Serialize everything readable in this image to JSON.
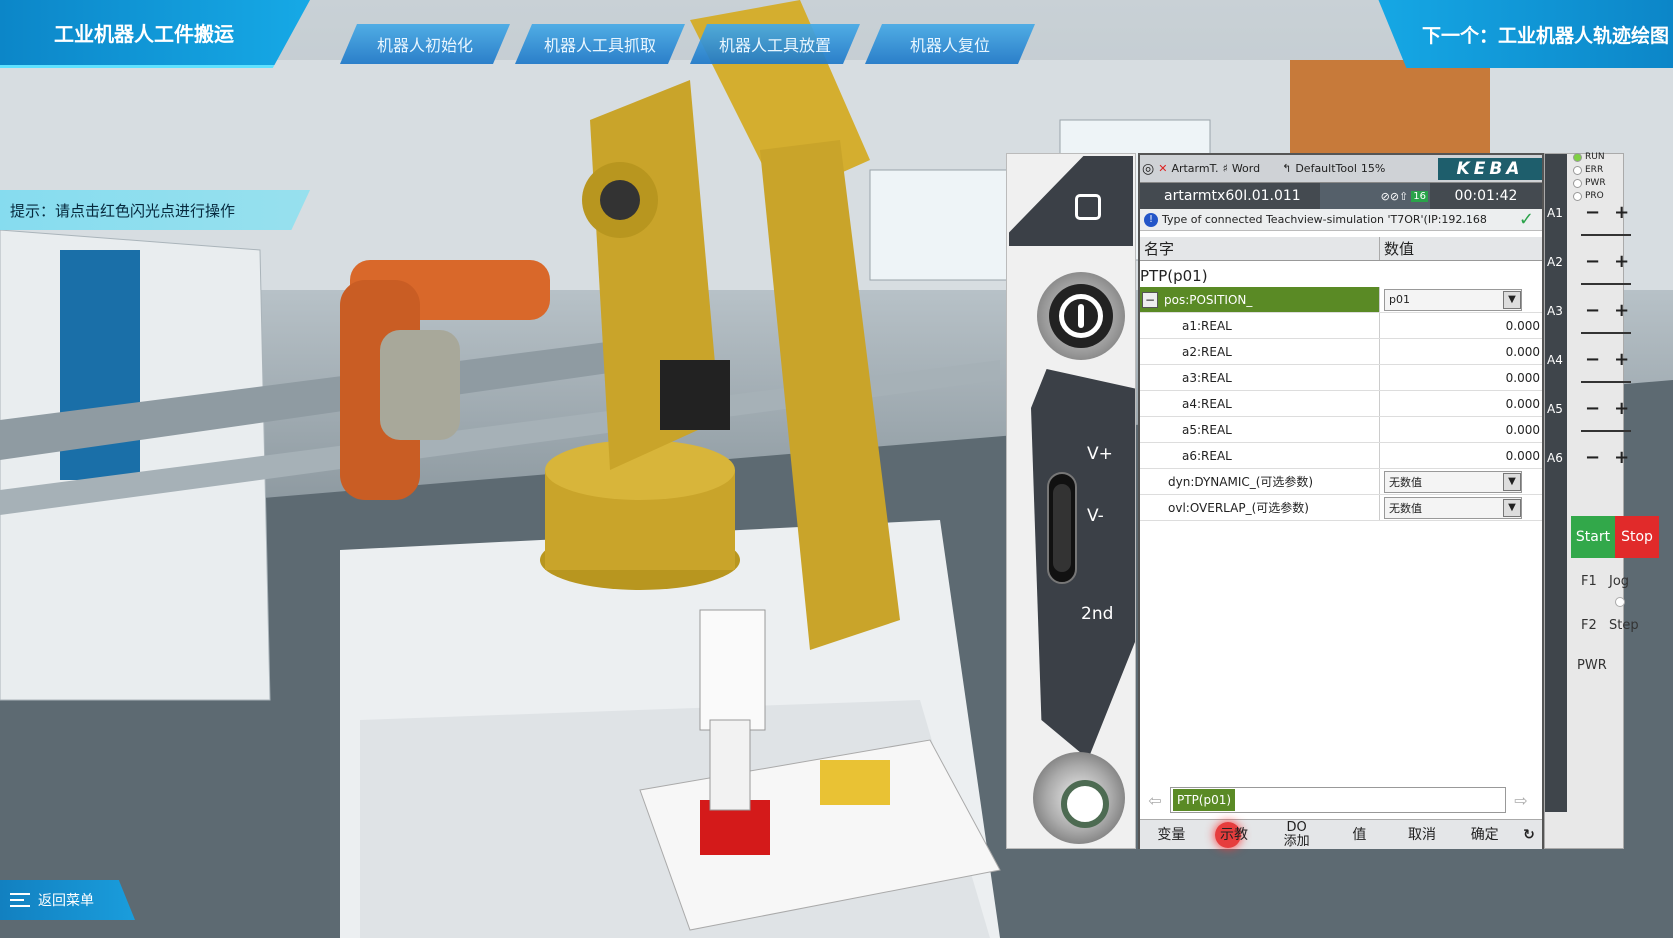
{
  "header": {
    "title": "工业机器人工件搬运",
    "next": "下一个：工业机器人轨迹绘图",
    "steps": [
      "机器人初始化",
      "机器人工具抓取",
      "机器人工具放置",
      "机器人复位"
    ]
  },
  "hint": "提示：请点击红色闪光点进行操作",
  "back_menu": "返回菜单",
  "pendant": {
    "status": {
      "user": "ArtarmT.",
      "frame": "Word",
      "tool": "DefaultTool",
      "override": "15%",
      "brand": "KEBA",
      "program": "artarmtx60I.01.011",
      "count": "16",
      "time": "00:01:42",
      "message": "Type of connected Teachview-simulation 'T7OR'(IP:192.168"
    },
    "columns": {
      "name": "名字",
      "value": "数值"
    },
    "command": "PTP(p01)",
    "pos_row": {
      "name": "pos:POSITION_",
      "value": "p01"
    },
    "rows": [
      {
        "name": "a1:REAL",
        "value": "0.000"
      },
      {
        "name": "a2:REAL",
        "value": "0.000"
      },
      {
        "name": "a3:REAL",
        "value": "0.000"
      },
      {
        "name": "a4:REAL",
        "value": "0.000"
      },
      {
        "name": "a5:REAL",
        "value": "0.000"
      },
      {
        "name": "a6:REAL",
        "value": "0.000"
      }
    ],
    "opt_rows": [
      {
        "name": "dyn:DYNAMIC_(可选参数)",
        "value": "无数值"
      },
      {
        "name": "ovl:OVERLAP_(可选参数)",
        "value": "无数值"
      }
    ],
    "cmdline": "PTP(p01)",
    "softkeys": {
      "variable": "变量",
      "teach": "示教",
      "do_add_1": "DO",
      "do_add_2": "添加",
      "value": "值",
      "cancel": "取消",
      "ok": "确定"
    },
    "speed": {
      "vplus": "V+",
      "vminus": "V-",
      "second": "2nd"
    },
    "leds": [
      "RUN",
      "ERR",
      "PWR",
      "PRO"
    ],
    "axes": [
      "A1",
      "A2",
      "A3",
      "A4",
      "A5",
      "A6"
    ],
    "start": "Start",
    "stop": "Stop",
    "f1": "F1",
    "jog": "Jog",
    "f2": "F2",
    "step": "Step",
    "pwr": "PWR"
  },
  "colors": {
    "accent": "#16a9e6",
    "robot": "#c9a42a",
    "selected": "#5a8a25",
    "start": "#32a84a",
    "stop": "#e12a2a"
  }
}
